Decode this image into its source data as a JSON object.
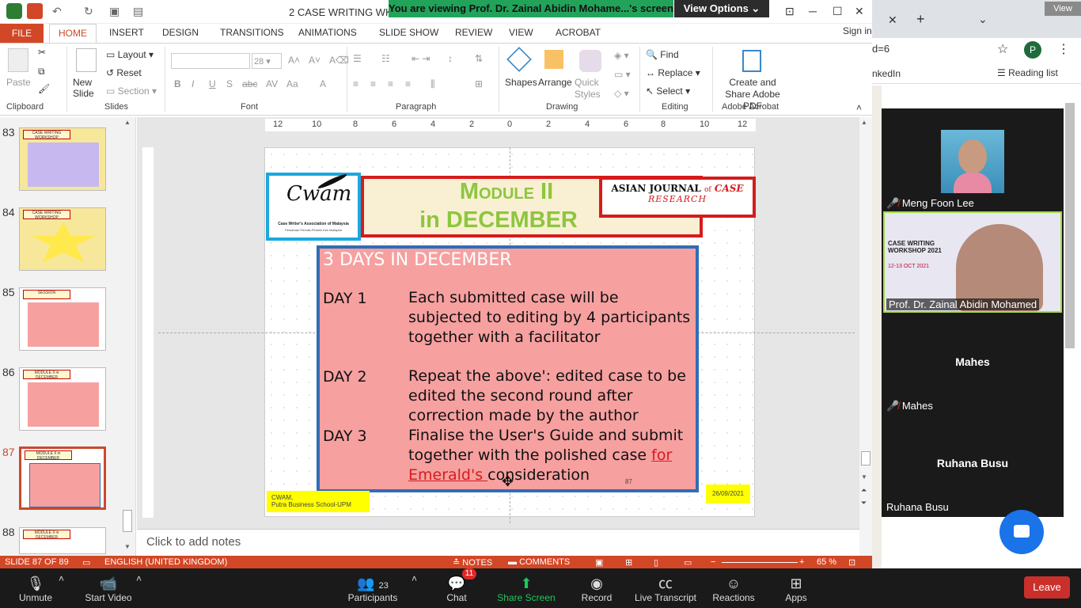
{
  "app": {
    "doc_title": "2 CASE WRITING WKSH",
    "sign_in": "Sign in"
  },
  "zoom_share": {
    "banner": "You are viewing Prof. Dr. Zainal Abidin Mohame...'s screen",
    "view_options": "View Options"
  },
  "tabs": [
    "FILE",
    "HOME",
    "INSERT",
    "DESIGN",
    "TRANSITIONS",
    "ANIMATIONS",
    "SLIDE SHOW",
    "REVIEW",
    "VIEW",
    "ACROBAT"
  ],
  "ribbon": {
    "paste": "Paste",
    "new_slide": "New Slide",
    "layout": "Layout",
    "reset": "Reset",
    "section": "Section",
    "font_size": "28",
    "shapes": "Shapes",
    "arrange": "Arrange",
    "quick_styles": "Quick Styles",
    "find": "Find",
    "replace": "Replace",
    "select": "Select",
    "create_share": "Create and Share Adobe PDF",
    "groups": [
      "Clipboard",
      "Slides",
      "Font",
      "Paragraph",
      "Drawing",
      "Editing",
      "Adobe Acrobat"
    ]
  },
  "thumbnails": [
    {
      "num": "83",
      "title": "CASE WRITING WORKSHOP"
    },
    {
      "num": "84",
      "title": "CASE WRITING WORKSHOP"
    },
    {
      "num": "85",
      "title": "SESSION"
    },
    {
      "num": "86",
      "title": "MODULE II in DECEMBER"
    },
    {
      "num": "87",
      "title": "MODULE II in DECEMBER"
    },
    {
      "num": "88",
      "title": "MODULE II in DECEMBER"
    }
  ],
  "ruler": {
    "h_ticks": [
      "12",
      "10",
      "8",
      "6",
      "4",
      "2",
      "0",
      "2",
      "4",
      "6",
      "8",
      "10",
      "12"
    ]
  },
  "slide": {
    "logo_text": "Cwam",
    "logo_sub": "Case Writer's Association of Malaysia",
    "logo_sub2": "Persatuan Penulis-Penulis Kes Malaysia",
    "title_line1": "Module II",
    "title_line2": "in DECEMBER",
    "ajcr_1": "ASIAN JOURNAL",
    "ajcr_of": "of",
    "ajcr_2": "CASE",
    "ajcr_3": "RESEARCH",
    "days_title": "3 DAYS IN DECEMBER",
    "day1_label": "DAY 1",
    "day1_text": "Each submitted case will be subjected to editing by 4 participants together with a facilitator",
    "day2_label": "DAY 2",
    "day2_text": " Repeat the above': edited case to be edited the second round after correction made by the author",
    "day3_label": "DAY 3",
    "day3_text_a": " Finalise the User's Guide and submit together with the polished case ",
    "day3_link": "for Emerald's ",
    "day3_text_b": "consideration",
    "footer_left_1": "CWAM,",
    "footer_left_2": "Putra Business School-UPM",
    "footer_date": "26/09/2021",
    "slide_number": "87"
  },
  "notes_placeholder": "Click to add notes",
  "status": {
    "slide": "SLIDE 87 OF 89",
    "language": "ENGLISH (UNITED KINGDOM)",
    "notes": "NOTES",
    "comments": "COMMENTS",
    "zoom": "65 %"
  },
  "browser": {
    "url_fragment": "d=6",
    "bookmark": "nkedIn",
    "reading_list": "Reading list",
    "profile": "P",
    "view": "View"
  },
  "participants": [
    {
      "name": "Meng Foon Lee",
      "muted": true
    },
    {
      "name": "Prof. Dr. Zainal Abidin Mohamed",
      "muted": false
    },
    {
      "name": "Mahes",
      "muted": true
    },
    {
      "name": "Ruhana Busu",
      "muted": false
    }
  ],
  "video_slide": {
    "title": "CASE WRITING WORKSHOP 2021",
    "date": "12-13 OCT 2021"
  },
  "toolbar": {
    "unmute": "Unmute",
    "start_video": "Start Video",
    "participants": "Participants",
    "participants_count": "23",
    "chat": "Chat",
    "chat_badge": "11",
    "share_screen": "Share Screen",
    "record": "Record",
    "live_transcript": "Live Transcript",
    "reactions": "Reactions",
    "apps": "Apps",
    "leave": "Leave"
  },
  "colors": {
    "ppt_accent": "#d24726",
    "share_green": "#21a35a",
    "zoom_blue": "#1a73e8",
    "leave_red": "#c9302c",
    "title_green": "#8dc63f"
  }
}
